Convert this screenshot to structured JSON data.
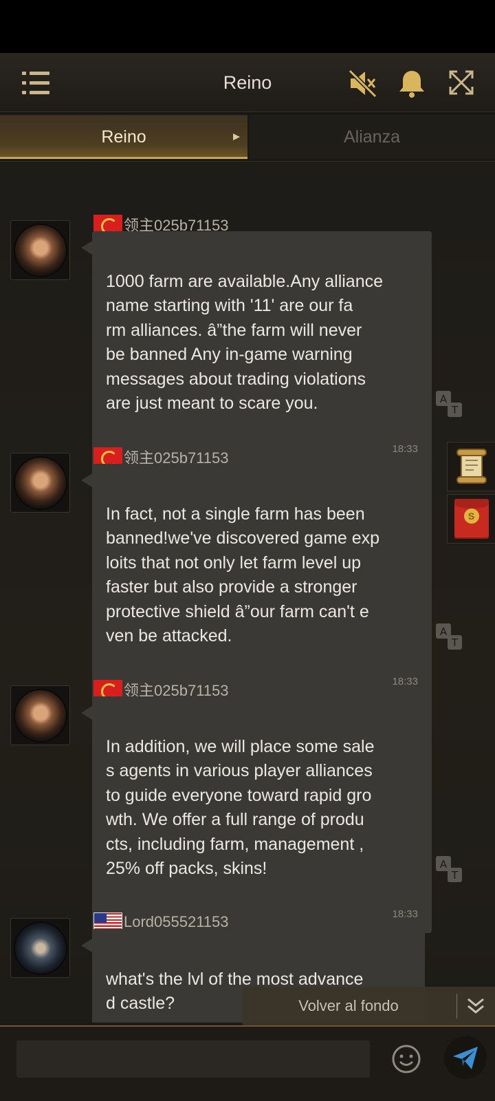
{
  "header": {
    "title": "Reino"
  },
  "tabs": [
    {
      "label": "Reino",
      "active": true
    },
    {
      "label": "Alianza",
      "active": false
    }
  ],
  "messages": [
    {
      "sender": "领主025b71153",
      "flag": "china-flag",
      "text": "1000 farm are available.Any alliance\n name starting with '11' are our fa\nrm alliances. â”the farm will never\n be banned Any in-game warning\nmessages about trading violations\nare just meant to scare you.",
      "time": "18:33"
    },
    {
      "sender": "领主025b71153",
      "flag": "china-flag",
      "text": "In fact, not a single farm has been\nbanned!we've discovered game exp\nloits that not only let farm level up\n faster but also provide a stronger\nprotective shield â”our farm can't e\nven be attacked.",
      "time": "18:33"
    },
    {
      "sender": "领主025b71153",
      "flag": "china-flag",
      "text": "In addition, we will place some sale\ns agents in various player alliances\n to guide everyone toward rapid gro\nwth. We offer a full range of produ\ncts, including farm, management ,\n25% off packs, skins!",
      "time": "18:33"
    },
    {
      "sender": "Lord055521153",
      "flag": "usa-flag",
      "text": "what's the lvl of the most advance\nd castle?",
      "time": ""
    }
  ],
  "side_buttons": {
    "coin_symbol": "S"
  },
  "back_to_bottom": {
    "label": "Volver al fondo"
  },
  "input": {
    "value": "",
    "placeholder": ""
  },
  "colors": {
    "accent_gold": "#c9a55a",
    "bubble": "#3b3935",
    "send_blue": "#3a8fd6"
  }
}
